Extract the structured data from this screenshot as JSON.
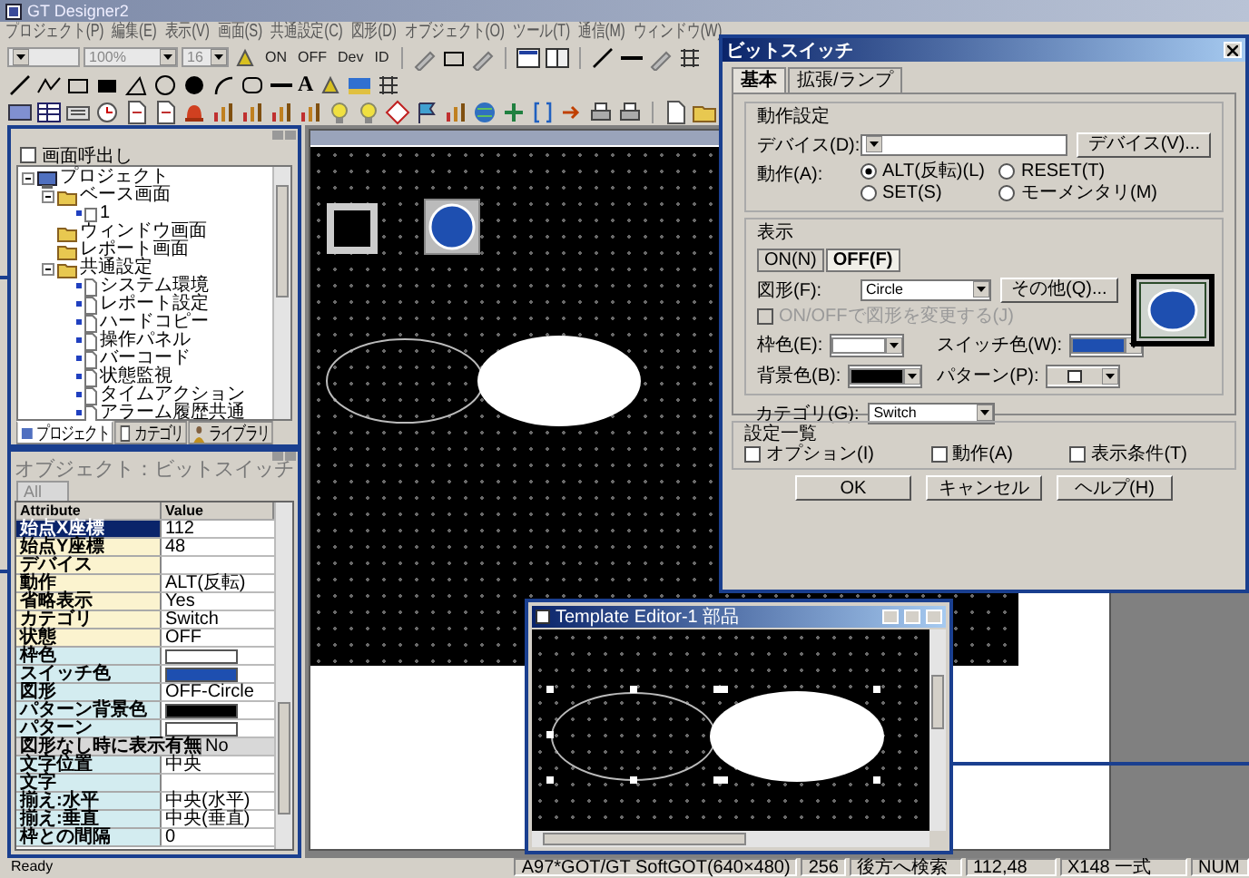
{
  "window": {
    "title": "GT Designer2"
  },
  "menu": [
    "プロジェクト(P)",
    "編集(E)",
    "表示(V)",
    "画面(S)",
    "共通設定(C)",
    "図形(D)",
    "オブジェクト(O)",
    "ツール(T)",
    "通信(M)",
    "ウィンドウ(W)"
  ],
  "toolbar": {
    "zoom": "100%",
    "font_size": "16",
    "buttons": [
      "ON",
      "OFF",
      "Dev",
      "ID"
    ],
    "text_tool": "A"
  },
  "tree_panel": {
    "option": {
      "label": "画面呼出し",
      "checked": false
    },
    "tree": [
      {
        "label": "プロジェクト",
        "kind": "project",
        "children": [
          {
            "label": "ベース画面",
            "kind": "folder",
            "children": [
              {
                "label": "1",
                "kind": "screen"
              }
            ]
          },
          {
            "label": "ウィンドウ画面",
            "kind": "folder"
          },
          {
            "label": "レポート画面",
            "kind": "folder"
          },
          {
            "label": "共通設定",
            "kind": "folder",
            "children": [
              {
                "label": "システム環境",
                "kind": "setting"
              },
              {
                "label": "レポート設定",
                "kind": "setting"
              },
              {
                "label": "ハードコピー",
                "kind": "setting"
              },
              {
                "label": "操作パネル",
                "kind": "setting"
              },
              {
                "label": "バーコード",
                "kind": "setting"
              },
              {
                "label": "状態監視",
                "kind": "setting"
              },
              {
                "label": "タイムアクション",
                "kind": "setting"
              },
              {
                "label": "アラーム履歴共通",
                "kind": "setting"
              }
            ]
          }
        ]
      }
    ],
    "tabs": [
      {
        "label": "プロジェクト",
        "selected": true
      },
      {
        "label": "カテゴリ",
        "selected": false
      },
      {
        "label": "ライブラリ",
        "selected": false
      }
    ]
  },
  "property_panel": {
    "title": "オブジェクト：ビットスイッチ",
    "tabs": [
      {
        "label": "All",
        "selected": true
      }
    ],
    "columns": [
      "Attribute",
      "Value"
    ],
    "rows": [
      {
        "attribute": "始点X座標",
        "value": "112",
        "kind": "basic",
        "selected": true
      },
      {
        "attribute": "始点Y座標",
        "value": "48",
        "kind": "basic",
        "selected": false
      },
      {
        "attribute": "デバイス",
        "kind": "basic",
        "selected": false
      },
      {
        "attribute": "動作",
        "value": "ALT(反転)",
        "kind": "basic",
        "selected": false
      },
      {
        "attribute": "省略表示",
        "value": "Yes",
        "kind": "basic",
        "selected": false
      },
      {
        "attribute": "カテゴリ",
        "value": "Switch",
        "kind": "basic",
        "selected": false
      },
      {
        "attribute": "状態",
        "value": "OFF",
        "kind": "basic",
        "selected": false
      },
      {
        "attribute": "枠色",
        "color": "#ffffff",
        "kind": "style",
        "selected": false
      },
      {
        "attribute": "スイッチ色",
        "color": "#1e4fb0",
        "kind": "style",
        "selected": false
      },
      {
        "attribute": "図形",
        "value": "OFF-Circle",
        "kind": "style",
        "selected": false
      },
      {
        "attribute": "パターン背景色",
        "color": "#000000",
        "kind": "style",
        "selected": false
      },
      {
        "attribute": "パターン",
        "color": "#ffffff",
        "kind": "style",
        "selected": false
      },
      {
        "attribute": "図形なし時に表示有無",
        "value": "No",
        "kind": "wide",
        "selected": false
      },
      {
        "attribute": "文字位置",
        "value": "中央",
        "kind": "style",
        "selected": false
      },
      {
        "attribute": "文字",
        "kind": "style",
        "selected": false
      },
      {
        "attribute": "揃え:水平",
        "value": "中央(水平)",
        "kind": "style",
        "selected": false
      },
      {
        "attribute": "揃え:垂直",
        "value": "中央(垂直)",
        "kind": "style",
        "selected": false
      },
      {
        "attribute": "枠との間隔",
        "value": "0",
        "kind": "style",
        "selected": false
      }
    ]
  },
  "dialog": {
    "title": "ビットスイッチ",
    "tabs": [
      {
        "label": "基本",
        "selected": true
      },
      {
        "label": "拡張/ランプ",
        "selected": false
      }
    ],
    "operation_group": {
      "title": "動作設定",
      "device_label": "デバイス(D):",
      "device_button": "デバイス(V)...",
      "action_label": "動作(A):",
      "actions": [
        {
          "label": "ALT(反転)(L)",
          "selected": true
        },
        {
          "label": "RESET(T)",
          "selected": false
        },
        {
          "label": "SET(S)",
          "selected": false
        },
        {
          "label": "モーメンタリ(M)",
          "selected": false
        }
      ]
    },
    "display_group": {
      "title": "表示",
      "state_tabs": [
        {
          "label": "ON(N)",
          "selected": false
        },
        {
          "label": "OFF(F)",
          "selected": true
        }
      ],
      "shape_label": "図形(F):",
      "shape_value": "Circle",
      "other_button": "その他(Q)...",
      "change_option": {
        "label": "ON/OFFで図形を変更する(J)",
        "checked": false,
        "disabled": true
      },
      "colors": [
        {
          "label": "枠色(E):",
          "kind": "color",
          "color": "#ffffff"
        },
        {
          "label": "スイッチ色(W):",
          "kind": "color",
          "color": "#1e4fb0"
        },
        {
          "label": "背景色(B):",
          "kind": "color",
          "color": "#000000"
        },
        {
          "label": "パターン(P):",
          "kind": "pattern"
        }
      ]
    },
    "category_label": "カテゴリ(G):",
    "category_value": "Switch",
    "settings": {
      "title": "設定一覧",
      "options": [
        {
          "label": "オプション(I)",
          "checked": false
        },
        {
          "label": "動作(A)",
          "checked": false
        },
        {
          "label": "表示条件(T)",
          "checked": false
        }
      ]
    },
    "buttons": [
      "OK",
      "キャンセル",
      "ヘルプ(H)"
    ]
  },
  "template_editor": {
    "title": "Template Editor-1 部品"
  },
  "status_bar": [
    "Ready",
    "A97*GOT/GT SoftGOT(640×480)",
    "256",
    "後方へ検索",
    "112,48",
    "X148 一式",
    "NUM"
  ]
}
